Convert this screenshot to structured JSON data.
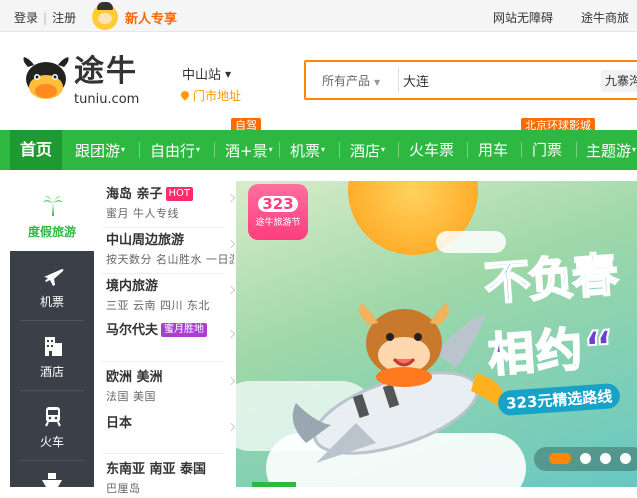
{
  "topbar": {
    "login": "登录",
    "register": "注册",
    "promo": "新人专享",
    "accessible": "网站无障碍",
    "business": "途牛商旅"
  },
  "header": {
    "logo_cn": "途牛",
    "logo_en": "tuniu.com",
    "station": "中山站",
    "store_address": "门市地址"
  },
  "search": {
    "category": "所有产品",
    "value": "大连",
    "hint": "九寨沟"
  },
  "nav": {
    "items": [
      "首页",
      "跟团游",
      "自由行",
      "酒+景",
      "机票",
      "酒店",
      "火车票",
      "用车",
      "门票",
      "主题游"
    ],
    "badges": [
      "自驾",
      "北京环球影城"
    ]
  },
  "sidebar": {
    "items": [
      "度假旅游",
      "机票",
      "酒店",
      "火车"
    ]
  },
  "submenu": {
    "groups": [
      {
        "title": "海岛 亲子",
        "tag": "HOT",
        "links": "蜜月 牛人专线"
      },
      {
        "title": "中山周边旅游",
        "links": "按天数分 名山胜水 一日游"
      },
      {
        "title": "境内旅游",
        "links": "三亚 云南 四川 东北"
      },
      {
        "title": "马尔代夫",
        "tag": "蜜月胜地",
        "links": ""
      },
      {
        "title": "欧洲 美洲",
        "links": "法国 美国"
      },
      {
        "title": "日本",
        "links": ""
      },
      {
        "title": "东南亚 南亚 泰国",
        "links": "巴厘岛"
      }
    ]
  },
  "banner": {
    "badge_num": "323",
    "badge_text": "途牛旅游节",
    "slogan1": "不负春",
    "slogan2": "相约“",
    "sale": "323元精选路线"
  },
  "colors": {
    "brand_green": "#2eb842",
    "accent_orange": "#ff8800",
    "sidebar_dark": "#3b4048"
  }
}
